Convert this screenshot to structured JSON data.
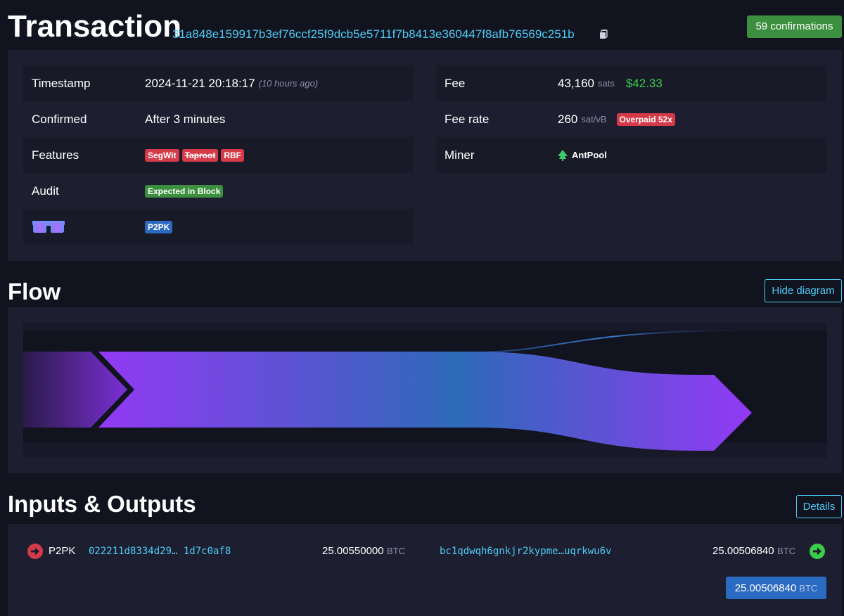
{
  "header": {
    "title": "Transaction",
    "txid": "31a848e159917b3ef76ccf25f9dcb5e5711f7b8413e360447f8afb76569c251b",
    "confirmations": "59 confirmations"
  },
  "details": {
    "left": [
      {
        "label": "Timestamp",
        "value": "2024-11-21 20:18:17",
        "note": "(10 hours ago)"
      },
      {
        "label": "Confirmed",
        "value": "After 3 minutes"
      },
      {
        "label": "Features",
        "tags": [
          "SegWit",
          "Taproot",
          "RBF"
        ]
      },
      {
        "label": "Audit",
        "tag": "Expected in Block"
      },
      {
        "label": "",
        "tag": "P2PK"
      }
    ],
    "right": [
      {
        "label": "Fee",
        "value": "43,160",
        "unit": "sats",
        "fiat": "$42.33"
      },
      {
        "label": "Fee rate",
        "value": "260",
        "unit": "sat/vB",
        "tag": "Overpaid 52x"
      },
      {
        "label": "Miner",
        "value": "AntPool"
      }
    ]
  },
  "flow": {
    "title": "Flow",
    "toggle_label": "Hide diagram"
  },
  "io": {
    "title": "Inputs & Outputs",
    "details_label": "Details",
    "input": {
      "type": "P2PK",
      "address": "022211d8334d29… 1d7c0af8",
      "amount": "25.00550000",
      "unit": "BTC"
    },
    "output": {
      "address": "bc1qdwqh6gnkjr2kypme…uqrkwu6v",
      "amount": "25.00506840",
      "unit": "BTC"
    },
    "total": {
      "amount": "25.00506840",
      "unit": "BTC"
    }
  },
  "colors": {
    "accent": "#4ecbf5",
    "success": "#3b8f3e",
    "danger": "#d43a48",
    "flow_purple": "#9339f4",
    "flow_blue": "#2d6ab8"
  }
}
